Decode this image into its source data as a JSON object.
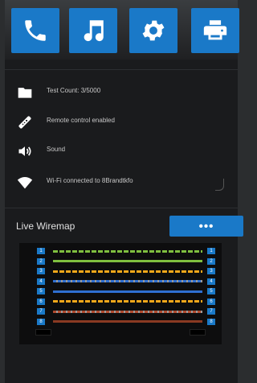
{
  "toolbar": {
    "buttons": [
      {
        "icon": "phone-icon"
      },
      {
        "icon": "music-icon"
      },
      {
        "icon": "gear-icon"
      },
      {
        "icon": "printer-icon"
      }
    ]
  },
  "status": {
    "items": [
      {
        "icon": "folder-icon",
        "text": "Test Count: 3/5000"
      },
      {
        "icon": "remote-control-icon",
        "text": "Remote control enabled"
      },
      {
        "icon": "speaker-icon",
        "text": "Sound"
      },
      {
        "icon": "wifi-icon",
        "text": "Wi-Fi connected to 8Brandtkfo"
      }
    ]
  },
  "wiremap": {
    "title": "Live Wiremap",
    "more_label": "•••",
    "pins_left": [
      "1",
      "2",
      "3",
      "4",
      "5",
      "6",
      "7",
      "8"
    ],
    "pins_right": [
      "1",
      "2",
      "3",
      "4",
      "5",
      "6",
      "7",
      "8"
    ],
    "pair_colors": [
      "#7fbf3f",
      "#7fbf3f",
      "#f2a71a",
      "#2f6fd1",
      "#2f6fd1",
      "#f2a71a",
      "#b04a2e",
      "#8a3a22"
    ]
  }
}
